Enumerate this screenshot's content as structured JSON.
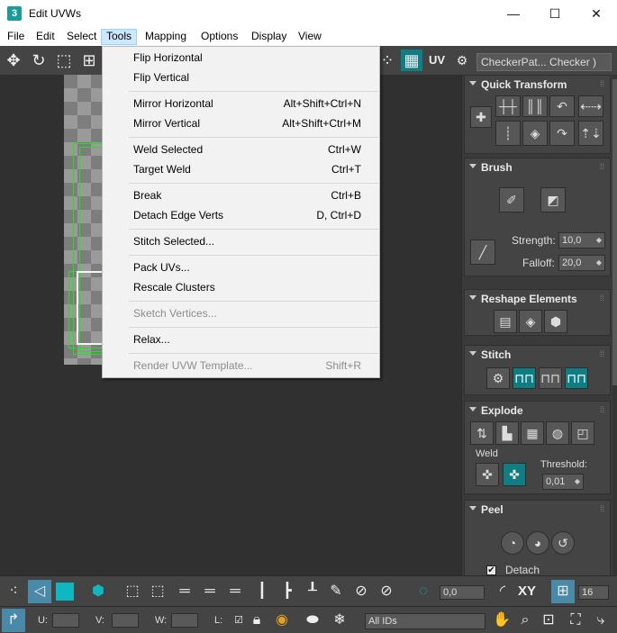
{
  "window": {
    "title": "Edit UVWs",
    "app_icon": "3",
    "minimize_icon": "—",
    "maximize_icon": "☐",
    "close_icon": "✕"
  },
  "menubar": {
    "items": [
      "File",
      "Edit",
      "Select",
      "Tools",
      "Mapping",
      "Options",
      "Display",
      "View"
    ],
    "active": "Tools"
  },
  "toolbar": {
    "uv_label": "UV",
    "checker_select": "CheckerPat... Checker )"
  },
  "tools_menu": {
    "items": [
      {
        "label": "Flip Horizontal",
        "shortcut": "",
        "enabled": true
      },
      {
        "label": "Flip Vertical",
        "shortcut": "",
        "enabled": true
      },
      {
        "label": "Mirror Horizontal",
        "shortcut": "Alt+Shift+Ctrl+N",
        "enabled": true
      },
      {
        "label": "Mirror Vertical",
        "shortcut": "Alt+Shift+Ctrl+M",
        "enabled": true
      },
      {
        "label": "Weld Selected",
        "shortcut": "Ctrl+W",
        "enabled": true
      },
      {
        "label": "Target Weld",
        "shortcut": "Ctrl+T",
        "enabled": true
      },
      {
        "label": "Break",
        "shortcut": "Ctrl+B",
        "enabled": true
      },
      {
        "label": "Detach Edge Verts",
        "shortcut": "D, Ctrl+D",
        "enabled": true
      },
      {
        "label": "Stitch Selected...",
        "shortcut": "",
        "enabled": true
      },
      {
        "label": "Pack UVs...",
        "shortcut": "",
        "enabled": true
      },
      {
        "label": "Rescale Clusters",
        "shortcut": "",
        "enabled": true
      },
      {
        "label": "Sketch Vertices...",
        "shortcut": "",
        "enabled": false
      },
      {
        "label": "Relax...",
        "shortcut": "",
        "enabled": true
      },
      {
        "label": "Render UVW Template...",
        "shortcut": "Shift+R",
        "enabled": false
      }
    ]
  },
  "panel": {
    "quick_transform": {
      "title": "Quick Transform"
    },
    "brush": {
      "title": "Brush",
      "strength_label": "Strength:",
      "strength_value": "10,0",
      "falloff_label": "Falloff:",
      "falloff_value": "20,0"
    },
    "reshape": {
      "title": "Reshape Elements"
    },
    "stitch": {
      "title": "Stitch"
    },
    "explode": {
      "title": "Explode",
      "weld_label": "Weld",
      "threshold_label": "Threshold:",
      "threshold_value": "0,01"
    },
    "peel": {
      "title": "Peel",
      "detach_label": "Detach",
      "detach_checked": true
    }
  },
  "bottom": {
    "angle_value": "0,0",
    "xy_label": "XY",
    "spin_value": "16",
    "u_label": "U:",
    "v_label": "V:",
    "w_label": "W:",
    "l_label": "L:",
    "ids_select": "All IDs"
  },
  "colors": {
    "accent_teal": "#0f7d84",
    "uv_green": "#23e023",
    "menu_highlight": "#cce8ff"
  }
}
